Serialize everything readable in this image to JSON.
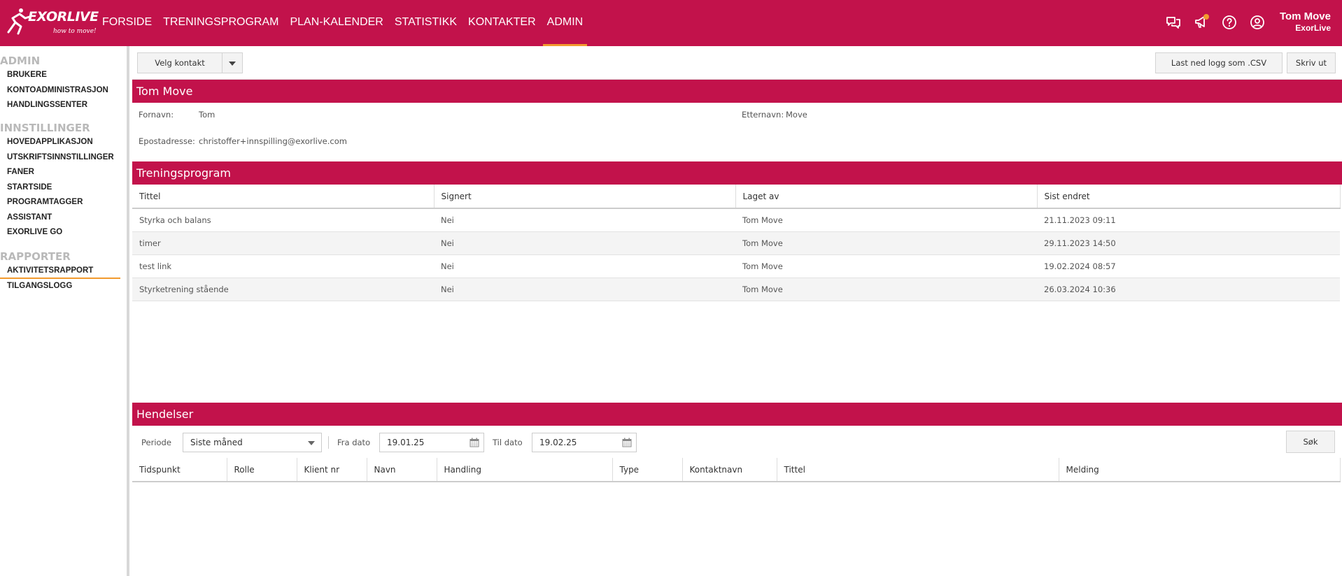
{
  "brand": {
    "logo_text": "EXORLIVE",
    "tagline": "how to move!",
    "primary_color": "#c2124b",
    "accent_color": "#f29a2e"
  },
  "nav": {
    "items": [
      {
        "label": "FORSIDE",
        "active": false
      },
      {
        "label": "TRENINGSPROGRAM",
        "active": false
      },
      {
        "label": "PLAN-KALENDER",
        "active": false
      },
      {
        "label": "STATISTIKK",
        "active": false
      },
      {
        "label": "KONTAKTER",
        "active": false
      },
      {
        "label": "ADMIN",
        "active": true
      }
    ]
  },
  "header_icons": [
    "chat-icon",
    "megaphone-icon",
    "help-icon",
    "user-circle-icon"
  ],
  "user": {
    "name": "Tom Move",
    "org": "ExorLive"
  },
  "sidebar": {
    "sections": [
      {
        "title": "ADMIN",
        "items": [
          "BRUKERE",
          "KONTOADMINISTRASJON",
          "HANDLINGSSENTER"
        ]
      },
      {
        "title": "INNSTILLINGER",
        "items": [
          "HOVEDAPPLIKASJON",
          "UTSKRIFTSINNSTILLINGER",
          "FANER",
          "STARTSIDE",
          "PROGRAMTAGGER",
          "ASSISTANT",
          "EXORLIVE GO"
        ]
      },
      {
        "title": "RAPPORTER",
        "items": [
          "AKTIVITETSRAPPORT",
          "TILGANGSLOGG"
        ]
      }
    ],
    "active_item": "AKTIVITETSRAPPORT"
  },
  "toolbar": {
    "contact_select_label": "Velg kontakt",
    "download_label": "Last ned logg som .CSV",
    "print_label": "Skriv ut"
  },
  "contact": {
    "title": "Tom Move",
    "first_name_label": "Fornavn:",
    "first_name": "Tom",
    "last_name_label": "Etternavn:",
    "last_name": "Move",
    "email_label": "Epostadresse:",
    "email": "christoffer+innspilling@exorlive.com"
  },
  "programs": {
    "title": "Treningsprogram",
    "columns": [
      "Tittel",
      "Signert",
      "Laget av",
      "Sist endret"
    ],
    "rows": [
      [
        "Styrka och balans",
        "Nei",
        "Tom Move",
        "21.11.2023 09:11"
      ],
      [
        "timer",
        "Nei",
        "Tom Move",
        "29.11.2023 14:50"
      ],
      [
        "test link",
        "Nei",
        "Tom Move",
        "19.02.2024 08:57"
      ],
      [
        "Styrketrening stående",
        "Nei",
        "Tom Move",
        "26.03.2024 10:36"
      ]
    ]
  },
  "events": {
    "title": "Hendelser",
    "period_label": "Periode",
    "period_value": "Siste måned",
    "from_label": "Fra dato",
    "from_value": "19.01.25",
    "to_label": "Til dato",
    "to_value": "19.02.25",
    "search_label": "Søk",
    "columns": [
      "Tidspunkt",
      "Rolle",
      "Klient nr",
      "Navn",
      "Handling",
      "Type",
      "Kontaktnavn",
      "Tittel",
      "Melding"
    ]
  }
}
